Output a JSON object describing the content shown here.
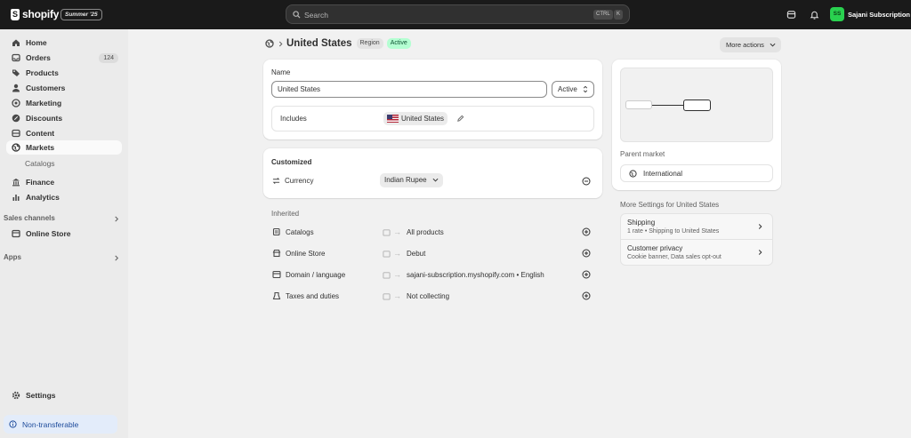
{
  "topbar": {
    "logo_text": "shopify",
    "edition": "Summer '25",
    "search_placeholder": "Search",
    "kbd_ctrl": "CTRL",
    "kbd_k": "K",
    "avatar_initials": "SS",
    "store_name": "Sajani Subscription"
  },
  "sidebar": {
    "home": "Home",
    "orders": "Orders",
    "orders_count": "124",
    "products": "Products",
    "customers": "Customers",
    "marketing": "Marketing",
    "discounts": "Discounts",
    "content": "Content",
    "markets": "Markets",
    "catalogs": "Catalogs",
    "finance": "Finance",
    "analytics": "Analytics",
    "sales_channels": "Sales channels",
    "online_store": "Online Store",
    "apps": "Apps",
    "settings": "Settings",
    "non_transferable": "Non-transferable"
  },
  "page": {
    "title": "United States",
    "badge_region": "Region",
    "badge_status": "Active",
    "more_actions": "More actions"
  },
  "name_card": {
    "name_label": "Name",
    "name_value": "United States",
    "status_select": "Active",
    "includes_label": "Includes",
    "includes_chip": "United States"
  },
  "customized": {
    "heading": "Customized",
    "currency_label": "Currency",
    "currency_value": "Indian Rupee"
  },
  "inherited": {
    "heading": "Inherited",
    "rows": [
      {
        "label": "Catalogs",
        "value": "All products"
      },
      {
        "label": "Online Store",
        "value": "Debut"
      },
      {
        "label": "Domain / language",
        "value": "sajani-subscription.myshopify.com • English"
      },
      {
        "label": "Taxes and duties",
        "value": "Not collecting"
      }
    ]
  },
  "right": {
    "parent_market_label": "Parent market",
    "parent_market_value": "International",
    "more_settings_heading": "More Settings for United States",
    "shipping_title": "Shipping",
    "shipping_sub": "1 rate • Shipping to United States",
    "privacy_title": "Customer privacy",
    "privacy_sub": "Cookie banner, Data sales opt-out"
  },
  "colors": {
    "topbar": "#1a1a1a",
    "active_badge": "#b4fed2",
    "avatar": "#29d14f",
    "non_transferable_bg": "#e3ecfa"
  }
}
